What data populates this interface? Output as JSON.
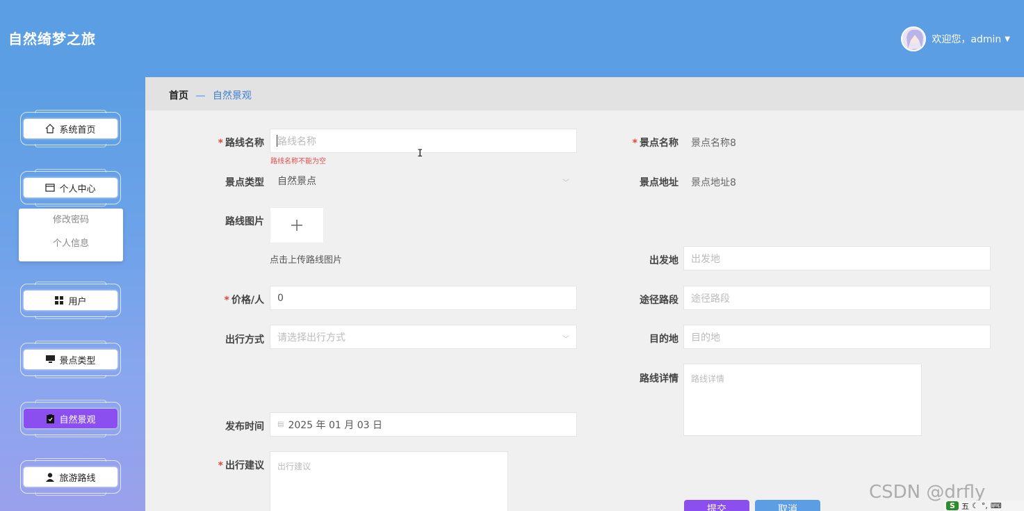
{
  "header": {
    "app_title": "自然绮梦之旅",
    "welcome": "欢迎您，admin"
  },
  "sidebar": {
    "items": [
      {
        "label": "系统首页",
        "icon": "home-icon"
      },
      {
        "label": "个人中心",
        "icon": "wallet-icon"
      },
      {
        "label": "用户",
        "icon": "grid-icon"
      },
      {
        "label": "景点类型",
        "icon": "monitor-icon"
      },
      {
        "label": "自然景观",
        "icon": "clipboard-icon",
        "active": true
      },
      {
        "label": "旅游路线",
        "icon": "user-icon"
      }
    ],
    "submenu": [
      "修改密码",
      "个人信息"
    ]
  },
  "breadcrumb": {
    "home": "首页",
    "separator": "—",
    "current": "自然景观"
  },
  "form": {
    "route_name": {
      "label": "路线名称",
      "placeholder": "路线名称",
      "error": "路线名称不能为空"
    },
    "spot_name": {
      "label": "景点名称",
      "value": "景点名称8"
    },
    "spot_type": {
      "label": "景点类型",
      "value": "自然景点"
    },
    "spot_address": {
      "label": "景点地址",
      "value": "景点地址8"
    },
    "route_image": {
      "label": "路线图片",
      "tip": "点击上传路线图片"
    },
    "departure": {
      "label": "出发地",
      "placeholder": "出发地"
    },
    "price": {
      "label": "价格/人",
      "value": "0"
    },
    "waypoints": {
      "label": "途径路段",
      "placeholder": "途径路段"
    },
    "travel_mode": {
      "label": "出行方式",
      "placeholder": "请选择出行方式"
    },
    "destination": {
      "label": "目的地",
      "placeholder": "目的地"
    },
    "route_detail": {
      "label": "路线详情",
      "placeholder": "路线详情"
    },
    "publish_time": {
      "label": "发布时间",
      "value": "2025 年 01 月 03 日"
    },
    "suggestion": {
      "label": "出行建议",
      "placeholder": "出行建议"
    }
  },
  "buttons": {
    "submit": "提交",
    "cancel": "取消"
  },
  "watermark": "CSDN @drfly"
}
